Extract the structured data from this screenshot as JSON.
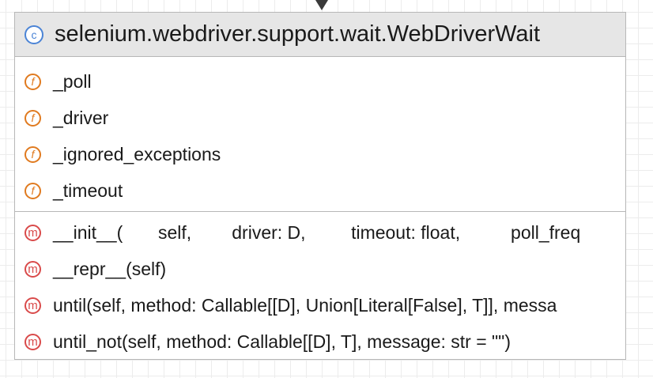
{
  "class": {
    "icon": "class-icon",
    "badge_letter": "c",
    "name": "selenium.webdriver.support.wait.WebDriverWait"
  },
  "fields": [
    {
      "badge": "f",
      "name": "_poll"
    },
    {
      "badge": "f",
      "name": "_driver"
    },
    {
      "badge": "f",
      "name": "_ignored_exceptions"
    },
    {
      "badge": "f",
      "name": "_timeout"
    }
  ],
  "methods": [
    {
      "badge": "m",
      "signature": "__init__(       self,        driver: D,         timeout: float,          poll_freq"
    },
    {
      "badge": "m",
      "signature": "__repr__(self)"
    },
    {
      "badge": "m",
      "signature": "until(self, method: Callable[[D], Union[Literal[False], T]], messa"
    },
    {
      "badge": "m",
      "signature": "until_not(self, method: Callable[[D], T], message: str = \"\")"
    }
  ],
  "colors": {
    "class_badge": "#4b84d6",
    "field_badge": "#e07a1f",
    "method_badge": "#d94a4a",
    "header_bg": "#e6e6e6"
  }
}
